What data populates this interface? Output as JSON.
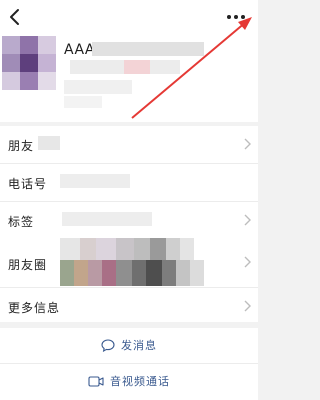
{
  "header": {
    "back_icon": "chevron-left-icon",
    "more_icon": "ellipsis-icon"
  },
  "profile": {
    "name": "AAA"
  },
  "rows": [
    {
      "label": "朋友",
      "chevron": true
    },
    {
      "label": "电话号",
      "chevron": false
    },
    {
      "label": "标签",
      "chevron": true
    },
    {
      "label": "朋友圈",
      "chevron": true
    },
    {
      "label": "更多信息",
      "chevron": true
    }
  ],
  "actions": {
    "message": {
      "label": "发消息",
      "icon": "chat-bubble-icon"
    },
    "video_call": {
      "label": "音视频通话",
      "icon": "video-camera-icon"
    }
  },
  "colors": {
    "annotation_arrow": "#e53935",
    "action_text": "#3a5a8f"
  }
}
